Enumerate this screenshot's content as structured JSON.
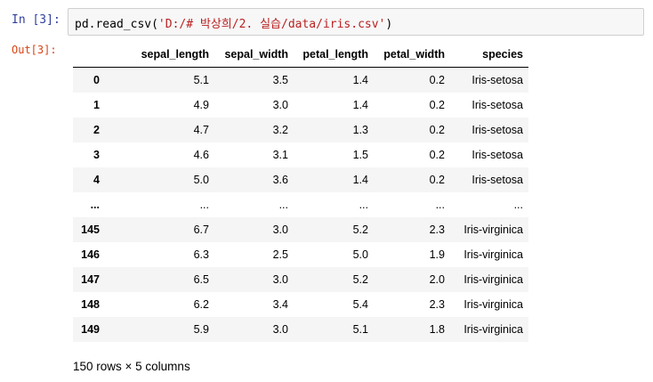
{
  "input_cell": {
    "prompt": "In [3]:",
    "code_prefix": "pd.read_csv(",
    "code_string": "'D:/# 박상희/2. 실습/data/iris.csv'",
    "code_suffix": ")"
  },
  "output_cell": {
    "prompt": "Out[3]:",
    "columns": [
      "sepal_length",
      "sepal_width",
      "petal_length",
      "petal_width",
      "species"
    ],
    "rows": [
      {
        "index": "0",
        "values": [
          "5.1",
          "3.5",
          "1.4",
          "0.2",
          "Iris-setosa"
        ]
      },
      {
        "index": "1",
        "values": [
          "4.9",
          "3.0",
          "1.4",
          "0.2",
          "Iris-setosa"
        ]
      },
      {
        "index": "2",
        "values": [
          "4.7",
          "3.2",
          "1.3",
          "0.2",
          "Iris-setosa"
        ]
      },
      {
        "index": "3",
        "values": [
          "4.6",
          "3.1",
          "1.5",
          "0.2",
          "Iris-setosa"
        ]
      },
      {
        "index": "4",
        "values": [
          "5.0",
          "3.6",
          "1.4",
          "0.2",
          "Iris-setosa"
        ]
      },
      {
        "index": "...",
        "values": [
          "...",
          "...",
          "...",
          "...",
          "..."
        ]
      },
      {
        "index": "145",
        "values": [
          "6.7",
          "3.0",
          "5.2",
          "2.3",
          "Iris-virginica"
        ]
      },
      {
        "index": "146",
        "values": [
          "6.3",
          "2.5",
          "5.0",
          "1.9",
          "Iris-virginica"
        ]
      },
      {
        "index": "147",
        "values": [
          "6.5",
          "3.0",
          "5.2",
          "2.0",
          "Iris-virginica"
        ]
      },
      {
        "index": "148",
        "values": [
          "6.2",
          "3.4",
          "5.4",
          "2.3",
          "Iris-virginica"
        ]
      },
      {
        "index": "149",
        "values": [
          "5.9",
          "3.0",
          "5.1",
          "1.8",
          "Iris-virginica"
        ]
      }
    ],
    "summary": "150 rows × 5 columns"
  },
  "colors": {
    "in_prompt": "#303f9f",
    "out_prompt": "#d84315",
    "string": "#ba2121"
  }
}
